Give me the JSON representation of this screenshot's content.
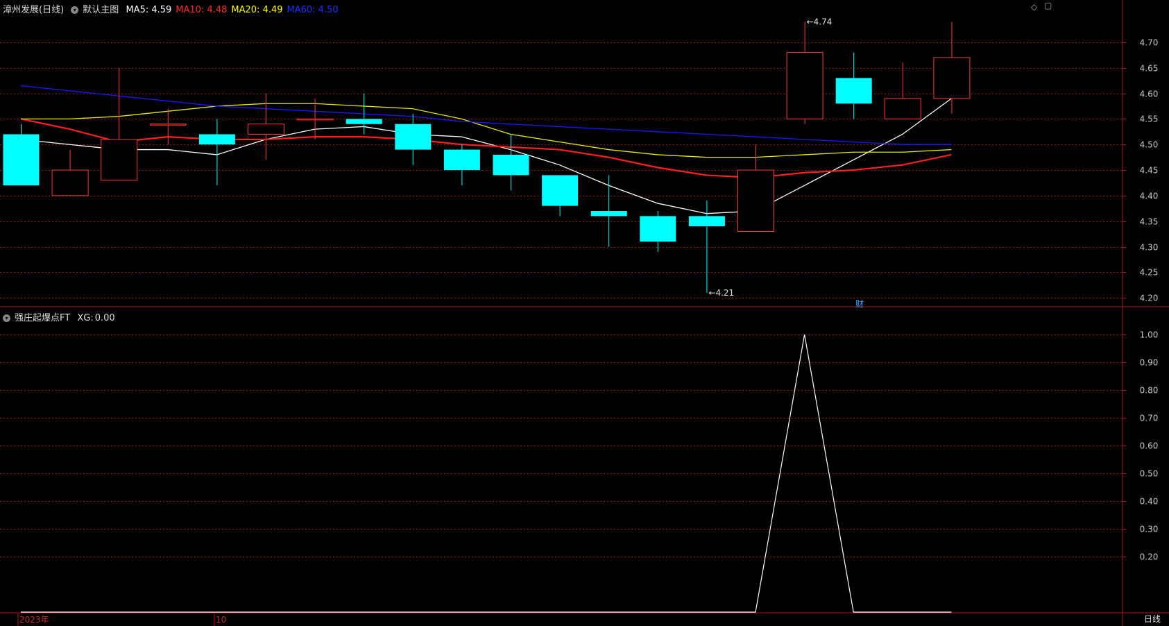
{
  "main_header": {
    "title": "漳州发展(日线)",
    "template": "默认主图",
    "ma": [
      {
        "label": "MA5:",
        "value": "4.59",
        "color": "#ffffff"
      },
      {
        "label": "MA10:",
        "value": "4.48",
        "color": "#ff3030"
      },
      {
        "label": "MA20:",
        "value": "4.49",
        "color": "#ffff00"
      },
      {
        "label": "MA60:",
        "value": "4.50",
        "color": "#2030ff"
      }
    ]
  },
  "indicator_header": {
    "name": "强庄起爆点FT",
    "xg_label": "XG:",
    "xg_value": "0.00"
  },
  "x_labels": {
    "year": "2023年",
    "month": "10"
  },
  "period_label": "日线",
  "fin_marker": "财",
  "colors": {
    "up": "#ff3a3a",
    "down": "#00ffff",
    "grid": "#8b1a1a",
    "frame": "#b01a1a",
    "ma5": "#ffffff",
    "ma10": "#ff2020",
    "ma20": "#e8e800",
    "ma60": "#1a1aff",
    "xg_line": "#ffffff"
  },
  "chart_data": [
    {
      "type": "candlestick",
      "title": "漳州发展(日线)",
      "ylim": [
        4.18,
        4.75
      ],
      "yticks": [
        "4.20",
        "4.25",
        "4.30",
        "4.35",
        "4.40",
        "4.45",
        "4.50",
        "4.55",
        "4.60",
        "4.65",
        "4.70"
      ],
      "candles": [
        {
          "o": 4.52,
          "h": 4.54,
          "l": 4.42,
          "c": 4.42
        },
        {
          "o": 4.4,
          "h": 4.49,
          "l": 4.4,
          "c": 4.45
        },
        {
          "o": 4.43,
          "h": 4.65,
          "l": 4.43,
          "c": 4.51
        },
        {
          "o": 4.54,
          "h": 4.57,
          "l": 4.5,
          "c": 4.54
        },
        {
          "o": 4.52,
          "h": 4.55,
          "l": 4.42,
          "c": 4.5
        },
        {
          "o": 4.52,
          "h": 4.6,
          "l": 4.47,
          "c": 4.54
        },
        {
          "o": 4.55,
          "h": 4.59,
          "l": 4.51,
          "c": 4.55
        },
        {
          "o": 4.55,
          "h": 4.6,
          "l": 4.52,
          "c": 4.54
        },
        {
          "o": 4.54,
          "h": 4.56,
          "l": 4.46,
          "c": 4.49
        },
        {
          "o": 4.49,
          "h": 4.5,
          "l": 4.42,
          "c": 4.45
        },
        {
          "o": 4.48,
          "h": 4.52,
          "l": 4.41,
          "c": 4.44
        },
        {
          "o": 4.44,
          "h": 4.44,
          "l": 4.36,
          "c": 4.38
        },
        {
          "o": 4.37,
          "h": 4.44,
          "l": 4.3,
          "c": 4.36
        },
        {
          "o": 4.36,
          "h": 4.37,
          "l": 4.29,
          "c": 4.31
        },
        {
          "o": 4.36,
          "h": 4.39,
          "l": 4.21,
          "c": 4.34
        },
        {
          "o": 4.33,
          "h": 4.5,
          "l": 4.33,
          "c": 4.45
        },
        {
          "o": 4.55,
          "h": 4.74,
          "l": 4.54,
          "c": 4.68
        },
        {
          "o": 4.63,
          "h": 4.68,
          "l": 4.55,
          "c": 4.58
        },
        {
          "o": 4.55,
          "h": 4.66,
          "l": 4.55,
          "c": 4.59
        },
        {
          "o": 4.59,
          "h": 4.74,
          "l": 4.56,
          "c": 4.67
        }
      ],
      "series": [
        {
          "name": "MA5",
          "values": [
            4.51,
            4.5,
            4.49,
            4.49,
            4.48,
            4.51,
            4.53,
            4.535,
            4.52,
            4.515,
            4.49,
            4.46,
            4.42,
            4.385,
            4.365,
            4.37,
            4.42,
            4.47,
            4.52,
            4.59
          ]
        },
        {
          "name": "MA10",
          "values": [
            4.55,
            4.53,
            4.505,
            4.515,
            4.51,
            4.51,
            4.515,
            4.515,
            4.51,
            4.5,
            4.495,
            4.49,
            4.475,
            4.455,
            4.44,
            4.435,
            4.445,
            4.45,
            4.46,
            4.48
          ]
        },
        {
          "name": "MA20",
          "values": [
            4.55,
            4.55,
            4.555,
            4.565,
            4.575,
            4.58,
            4.58,
            4.575,
            4.57,
            4.55,
            4.52,
            4.505,
            4.49,
            4.48,
            4.475,
            4.475,
            4.48,
            4.485,
            4.485,
            4.49
          ]
        },
        {
          "name": "MA60",
          "values": [
            4.615,
            4.605,
            4.595,
            4.585,
            4.575,
            4.57,
            4.565,
            4.56,
            4.555,
            4.545,
            4.54,
            4.535,
            4.53,
            4.525,
            4.52,
            4.515,
            4.51,
            4.505,
            4.5,
            4.5
          ]
        }
      ],
      "annotations": [
        {
          "text": "4.74",
          "index": 16,
          "value": 4.74
        },
        {
          "text": "4.21",
          "index": 14,
          "value": 4.21
        }
      ]
    },
    {
      "type": "line",
      "title": "强庄起爆点FT",
      "ylim": [
        0.0,
        1.04
      ],
      "yticks": [
        "0.20",
        "0.30",
        "0.40",
        "0.50",
        "0.60",
        "0.70",
        "0.80",
        "0.90",
        "1.00"
      ],
      "series": [
        {
          "name": "XG",
          "values": [
            0,
            0,
            0,
            0,
            0,
            0,
            0,
            0,
            0,
            0,
            0,
            0,
            0,
            0,
            0,
            0,
            1,
            0,
            0,
            0
          ]
        }
      ]
    }
  ]
}
